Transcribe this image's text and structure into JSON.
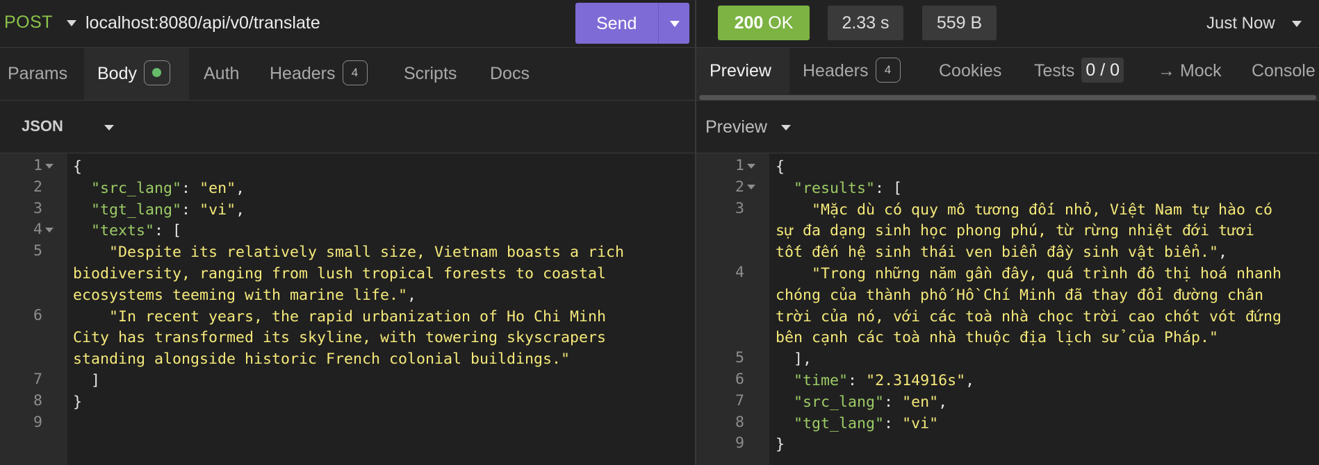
{
  "request": {
    "method": "POST",
    "url": "localhost:8080/api/v0/translate",
    "send_label": "Send"
  },
  "request_tabs": {
    "params": "Params",
    "body": "Body",
    "auth": "Auth",
    "headers": "Headers",
    "headers_count": "4",
    "scripts": "Scripts",
    "docs": "Docs"
  },
  "body_format": "JSON",
  "request_body": {
    "line_numbers": [
      "1",
      "2",
      "3",
      "4",
      "5",
      "",
      "",
      "6",
      "",
      "",
      "7",
      "8",
      "9"
    ],
    "lines": [
      "{",
      "  \"src_lang\": \"en\",",
      "  \"tgt_lang\": \"vi\",",
      "  \"texts\": [",
      "    \"Despite its relatively small size, Vietnam boasts a rich",
      "biodiversity, ranging from lush tropical forests to coastal",
      "ecosystems teeming with marine life.\",",
      "    \"In recent years, the rapid urbanization of Ho Chi Minh",
      "City has transformed its skyline, with towering skyscrapers",
      "standing alongside historic French colonial buildings.\"",
      "  ]",
      "}",
      ""
    ]
  },
  "response": {
    "status_code": "200",
    "status_text": "OK",
    "time": "2.33 s",
    "size": "559 B",
    "history": "Just Now"
  },
  "response_tabs": {
    "preview": "Preview",
    "headers": "Headers",
    "headers_count": "4",
    "cookies": "Cookies",
    "tests": "Tests",
    "tests_count": "0 / 0",
    "mock": "→ Mock",
    "console": "Console"
  },
  "preview_mode": "Preview",
  "response_body": {
    "line_numbers": [
      "1",
      "2",
      "3",
      "",
      "",
      "4",
      "",
      "",
      "",
      "5",
      "6",
      "7",
      "8",
      "9"
    ],
    "lines": [
      "{",
      "  \"results\": [",
      "    \"Mặc dù có quy mô tương đối nhỏ, Việt Nam tự hào có",
      "sự đa dạng sinh học phong phú, từ rừng nhiệt đới tươi",
      "tốt đến hệ sinh thái ven biển đầy sinh vật biển.\",",
      "    \"Trong những năm gần đây, quá trình đô thị hoá nhanh",
      "chóng của thành phố Hồ Chí Minh đã thay đổi đường chân",
      "trời của nó, với các toà nhà chọc trời cao chót vót đứng",
      "bên cạnh các toà nhà thuộc địa lịch sử của Pháp.\"",
      "  ],",
      "  \"time\": \"2.314916s\",",
      "  \"src_lang\": \"en\",",
      "  \"tgt_lang\": \"vi\"",
      "}"
    ]
  },
  "colors": {
    "method": "#8bc34a",
    "send_button": "#7f6bd6",
    "status_ok": "#7cb342",
    "json_key": "#9ccc65",
    "json_string": "#f5e97a"
  }
}
